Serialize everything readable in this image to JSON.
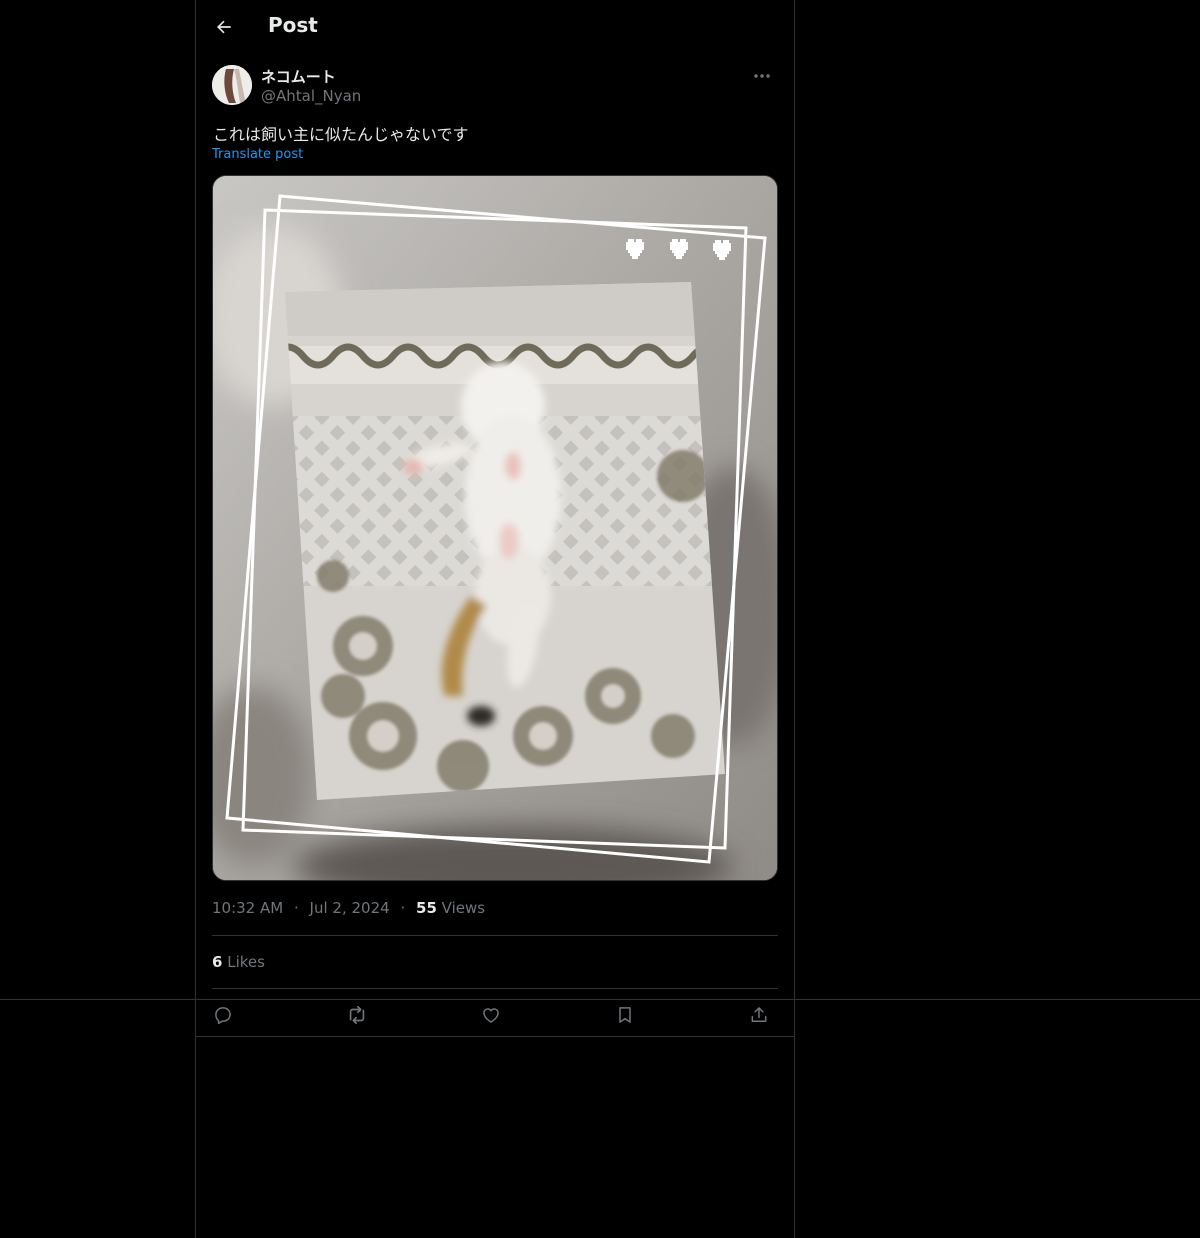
{
  "header": {
    "title": "Post"
  },
  "author": {
    "display_name": "ネコムート",
    "handle": "@Ahtal_Nyan"
  },
  "post": {
    "text": "これは飼い主に似たんじゃないです",
    "translate_label": "Translate post"
  },
  "meta": {
    "time": "10:32 AM",
    "separator": "·",
    "date": "Jul 2, 2024",
    "views_count": "55",
    "views_label": "Views"
  },
  "engagement": {
    "likes_count": "6",
    "likes_label": "Likes"
  },
  "actions": [
    "reply-icon",
    "repost-icon",
    "like-icon",
    "bookmark-icon",
    "share-icon"
  ],
  "colors": {
    "background": "#000000",
    "text": "#e7e9ea",
    "muted": "#71767b",
    "accent": "#1d9bf0",
    "border": "#2f3336"
  }
}
